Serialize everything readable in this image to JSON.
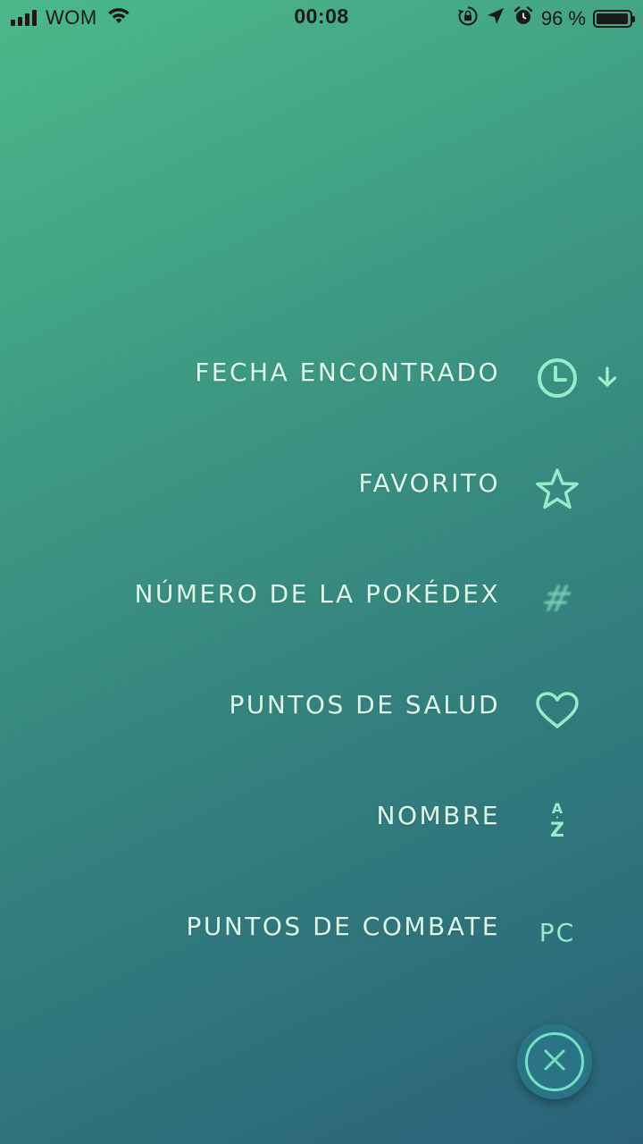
{
  "status_bar": {
    "carrier": "WOM",
    "time": "00:08",
    "battery_percent": "96 %",
    "battery_level": 0.96,
    "icons": [
      "signal-icon",
      "wifi-icon",
      "rotation-lock-icon",
      "location-arrow-icon",
      "alarm-icon",
      "battery-icon"
    ]
  },
  "sort_menu": {
    "items": [
      {
        "label": "FECHA ENCONTRADO",
        "icon": "clock-icon",
        "selected": true,
        "direction": "descending"
      },
      {
        "label": "FAVORITO",
        "icon": "star-icon"
      },
      {
        "label": "NÚMERO DE LA POKÉDEX",
        "icon": "hash-icon",
        "icon_text": "#"
      },
      {
        "label": "PUNTOS DE SALUD",
        "icon": "heart-icon"
      },
      {
        "label": "NOMBRE",
        "icon": "az-icon",
        "icon_text_top": "A",
        "icon_text_bottom": "Z"
      },
      {
        "label": "PUNTOS DE COMBATE",
        "icon": "pc-icon",
        "icon_text": "PC"
      }
    ]
  },
  "close_button": {
    "icon": "close-icon"
  },
  "colors": {
    "background_top": "#4cb88a",
    "background_bottom": "#2a627a",
    "label_text": "#def6e6",
    "icon_accent": "#96ebc9",
    "fab_background": "#2b7486",
    "fab_ring": "#74e0c4"
  }
}
